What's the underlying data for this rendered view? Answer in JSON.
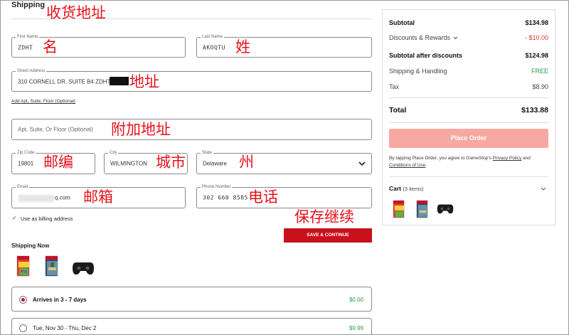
{
  "shipping": {
    "title": "Shipping",
    "first_name": {
      "label": "First Name",
      "value": "ZDHT"
    },
    "last_name": {
      "label": "Last Name",
      "value": "AKOQTU"
    },
    "street": {
      "label": "Street Address",
      "value": "310 CORNELL DR. SUITE B4 ZDHT"
    },
    "add_apt_link": "Add Apt, Suite, Floor (Optional)",
    "apt": {
      "placeholder": "Apt, Suite, Or Floor (Optional)"
    },
    "zip": {
      "label": "Zip Code",
      "value": "19801"
    },
    "city": {
      "label": "City",
      "value": "WILMINGTON"
    },
    "state": {
      "label": "State",
      "value": "Delaware"
    },
    "email": {
      "label": "Email",
      "value": "q.com"
    },
    "phone": {
      "label": "Phone Number",
      "value": "302 660 8585"
    },
    "billing_checkbox": {
      "label": "Use as billing address",
      "checked": true
    },
    "save_button": "SAVE & CONTINUE",
    "shipping_now": "Shipping Now",
    "options": [
      {
        "label": "Arrives in 3 - 7 days",
        "price": "$0.00",
        "selected": true
      },
      {
        "label": "Tue, Nov 30 - Thu, Dec 2",
        "price": "$9.99",
        "selected": false
      }
    ]
  },
  "annotations": {
    "title": "收货地址",
    "first_name": "名",
    "last_name": "姓",
    "street": "地址",
    "apt": "附加地址",
    "zip": "邮编",
    "city": "城市",
    "state": "州",
    "email": "邮箱",
    "phone": "电话",
    "save": "保存继续"
  },
  "summary": {
    "subtotal_label": "Subtotal",
    "subtotal": "$134.98",
    "discounts_label": "Discounts & Rewards",
    "discounts": "- $10.00",
    "after_label": "Subtotal after discounts",
    "after": "$124.98",
    "shipping_label": "Shipping & Handling",
    "shipping": "FREE",
    "tax_label": "Tax",
    "tax": "$8.90",
    "total_label": "Total",
    "total": "$133.88",
    "place_order": "Place Order",
    "legal_prefix": "By tapping Place Order, you agree to GameStop's ",
    "privacy": "Privacy Policy",
    "legal_and": " and ",
    "conditions": "Conditions of Use",
    "legal_suffix": ".",
    "cart_label": "Cart",
    "cart_count": "(3 items)"
  },
  "colors": {
    "brand_red": "#c8111d",
    "place_order_disabled": "#f7a8a1",
    "annotation": "#e8111b"
  }
}
